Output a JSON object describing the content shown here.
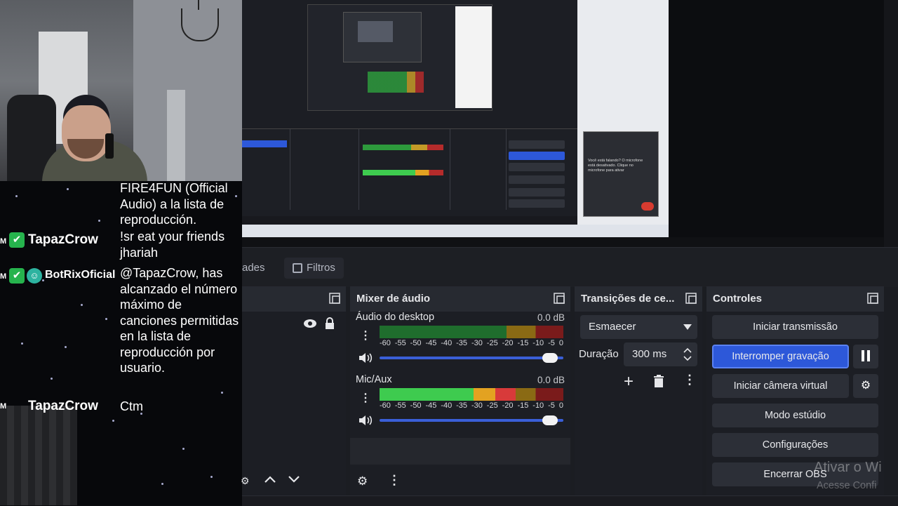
{
  "chat": {
    "messages": [
      {
        "text": "FIRE4FUN (Official Audio) a la lista de reproducción."
      },
      {
        "prefix": "M",
        "user": "TapazCrow",
        "text": "!sr eat your friends jhariah"
      },
      {
        "prefix": "M",
        "user": "BotRixOficial",
        "text": "@TapazCrow, has alcanzado el número máximo de canciones permitidas en la lista de reproducción por usuario."
      },
      {
        "prefix": "M",
        "user": "TapazCrow",
        "text": "Ctm"
      }
    ]
  },
  "preview": {
    "phone_text": "Você está falando? O microfone está desativado. Clique no microfone para ativar"
  },
  "tabs": [
    {
      "label": "ades"
    },
    {
      "label": "Filtros"
    }
  ],
  "mixer": {
    "title": "Mixer de áudio",
    "ticks": [
      "-60",
      "-55",
      "-50",
      "-45",
      "-40",
      "-35",
      "-30",
      "-25",
      "-20",
      "-15",
      "-10",
      "-5",
      "0"
    ],
    "channels": [
      {
        "name": "Áudio do desktop",
        "db": "0.0 dB",
        "level": 0.0,
        "volume": 0.97
      },
      {
        "name": "Mic/Aux",
        "db": "0.0 dB",
        "level": 0.74,
        "volume": 0.97
      }
    ]
  },
  "transitions": {
    "title": "Transições de ce...",
    "selected": "Esmaecer",
    "duration_label": "Duração",
    "duration_value": "300 ms"
  },
  "controls": {
    "title": "Controles",
    "start_stream": "Iniciar transmissão",
    "stop_recording": "Interromper gravação",
    "start_virtual_cam": "Iniciar câmera virtual",
    "studio_mode": "Modo estúdio",
    "settings": "Configurações",
    "exit": "Encerrar OBS"
  },
  "watermark": {
    "line1": "Ativar o Wi",
    "line2": "Acesse Confi"
  },
  "colors": {
    "accent": "#2d58d9",
    "meter_green": "#3ecb4f",
    "meter_yellow": "#e3a221",
    "meter_red": "#d83a3a",
    "badge_green": "#26b34d"
  }
}
